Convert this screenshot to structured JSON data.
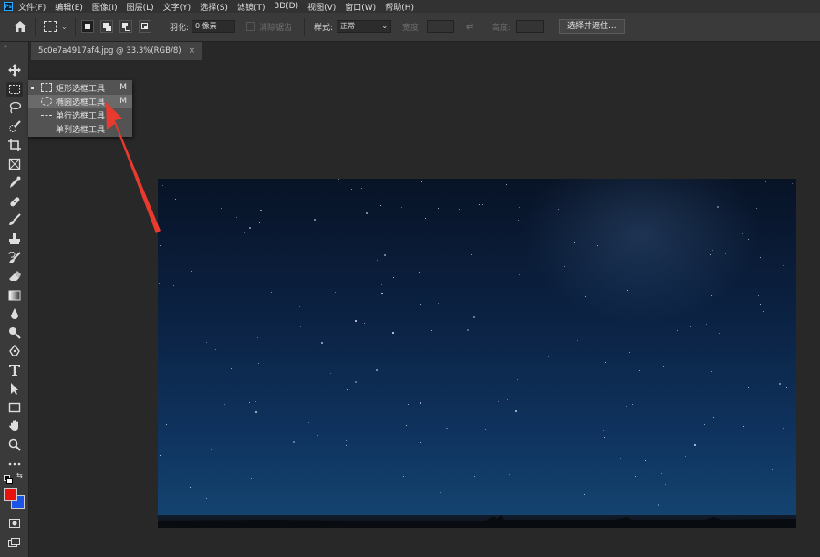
{
  "app": {
    "logo_text": "Ps"
  },
  "menu": [
    "文件(F)",
    "编辑(E)",
    "图像(I)",
    "图层(L)",
    "文字(Y)",
    "选择(S)",
    "滤镜(T)",
    "3D(D)",
    "视图(V)",
    "窗口(W)",
    "帮助(H)"
  ],
  "options": {
    "feather_label": "羽化:",
    "feather_value": "0 像素",
    "antialias_label": "消除锯齿",
    "style_label": "样式:",
    "style_value": "正常",
    "width_label": "宽度:",
    "height_label": "高度:",
    "mask_button": "选择并遮住..."
  },
  "document": {
    "tab_title": "5c0e7a4917af4.jpg @ 33.3%(RGB/8)",
    "close_glyph": "×"
  },
  "flyout": {
    "items": [
      {
        "label": "矩形选框工具",
        "shortcut": "M",
        "current": true,
        "highlighted": false,
        "icon": "rect-marquee-icon"
      },
      {
        "label": "椭圆选框工具",
        "shortcut": "M",
        "current": false,
        "highlighted": true,
        "icon": "ellipse-marquee-icon"
      },
      {
        "label": "单行选框工具",
        "shortcut": "",
        "current": false,
        "highlighted": false,
        "icon": "single-row-marquee-icon"
      },
      {
        "label": "单列选框工具",
        "shortcut": "",
        "current": false,
        "highlighted": false,
        "icon": "single-column-marquee-icon"
      }
    ]
  },
  "tools": [
    "move",
    "rect-marquee",
    "lasso",
    "quick-select",
    "crop",
    "frame",
    "eyedropper",
    "healing-brush",
    "brush",
    "clone-stamp",
    "history-brush",
    "eraser",
    "gradient",
    "blur",
    "dodge",
    "pen",
    "type",
    "path-select",
    "rectangle",
    "hand",
    "zoom",
    "more"
  ],
  "colors": {
    "foreground": "#e8120c",
    "background": "#1c54e6",
    "annotation_arrow": "#e83a2e",
    "ui_dark": "#282828"
  }
}
